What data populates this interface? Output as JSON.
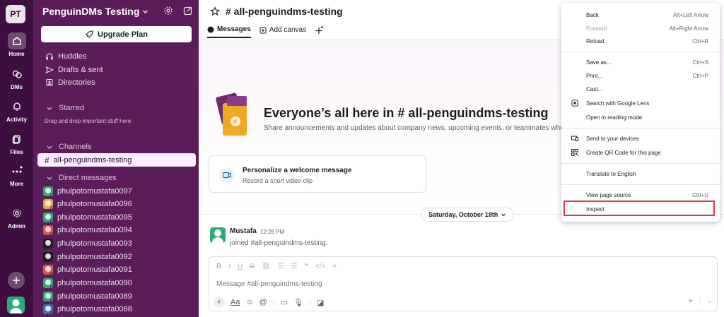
{
  "workspace": {
    "initials": "PT",
    "name": "PenguinDMs Testing"
  },
  "rail": [
    {
      "label": "Home",
      "icon": "home-icon"
    },
    {
      "label": "DMs",
      "icon": "dms-icon"
    },
    {
      "label": "Activity",
      "icon": "bell-icon"
    },
    {
      "label": "Files",
      "icon": "files-icon"
    },
    {
      "label": "More",
      "icon": "more-icon"
    },
    {
      "label": "Admin",
      "icon": "gear-icon"
    }
  ],
  "sidebar": {
    "upgrade_label": "Upgrade Plan",
    "nav": [
      {
        "label": "Huddles",
        "icon": "headphones-icon"
      },
      {
        "label": "Drafts & sent",
        "icon": "send-icon"
      },
      {
        "label": "Directories",
        "icon": "directory-icon"
      }
    ],
    "starred_label": "Starred",
    "starred_hint": "Drag and drop important stuff here",
    "channels_label": "Channels",
    "active_channel": "all-penguindms-testing",
    "dms_label": "Direct messages",
    "dms": [
      {
        "name": "phulpotomustafa0097",
        "color": "#2bac76"
      },
      {
        "name": "phulpotomustafa0096",
        "color": "#e8a93c"
      },
      {
        "name": "phulpotomustafa0095",
        "color": "#2bac76"
      },
      {
        "name": "phulpotomustafa0094",
        "color": "#e0563f"
      },
      {
        "name": "phulpotomustafa0093",
        "color": "#1d1c1d"
      },
      {
        "name": "phulpotomustafa0092",
        "color": "#1d1c1d"
      },
      {
        "name": "phulpotomustafa0091",
        "color": "#e0563f"
      },
      {
        "name": "phulpotomustafa0090",
        "color": "#2bac76"
      },
      {
        "name": "phulpotomustafa0089",
        "color": "#2bac76"
      },
      {
        "name": "phulpotomustafa0088",
        "color": "#3a6fb5"
      }
    ]
  },
  "main": {
    "channel_title": "# all-penguindms-testing",
    "tabs": [
      {
        "label": "Messages"
      },
      {
        "label": "Add canvas"
      }
    ],
    "hero_title": "Everyone’s all here in # all-penguindms-testing",
    "hero_sub": "Share announcements and updates about company news, upcoming events, or teammates who d",
    "card_title": "Personalize a welcome message",
    "card_sub": "Record a short video clip",
    "date_label": "Saturday, October 18th",
    "message": {
      "author": "Mustafa",
      "time": "12:28 PM",
      "text": "joined #all-penguindms-testing."
    },
    "composer_placeholder": "Message #all-penguindms-testing",
    "composer_format_aa": "Aa"
  },
  "context_menu": {
    "items": [
      {
        "label": "Back",
        "shortcut": "Alt+Left Arrow",
        "disabled": false
      },
      {
        "label": "Forward",
        "shortcut": "Alt+Right Arrow",
        "disabled": true
      },
      {
        "label": "Reload",
        "shortcut": "Ctrl+R",
        "disabled": false
      },
      {
        "label": "Save as...",
        "shortcut": "Ctrl+S",
        "disabled": false
      },
      {
        "label": "Print...",
        "shortcut": "Ctrl+P",
        "disabled": false
      },
      {
        "label": "Cast...",
        "shortcut": "",
        "disabled": false
      },
      {
        "label": "Search with Google Lens",
        "shortcut": "",
        "disabled": false
      },
      {
        "label": "Open in reading mode",
        "shortcut": "",
        "disabled": false
      },
      {
        "label": "Send to your devices",
        "shortcut": "",
        "disabled": false
      },
      {
        "label": "Create QR Code for this page",
        "shortcut": "",
        "disabled": false
      },
      {
        "label": "Translate to English",
        "shortcut": "",
        "disabled": false
      },
      {
        "label": "View page source",
        "shortcut": "Ctrl+U",
        "disabled": false
      },
      {
        "label": "Inspect",
        "shortcut": "",
        "disabled": false
      }
    ]
  },
  "colors": {
    "rail_bg": "#3f0e40",
    "sidebar_bg": "#5a1d5a",
    "highlight_box": "#e03a3a"
  }
}
